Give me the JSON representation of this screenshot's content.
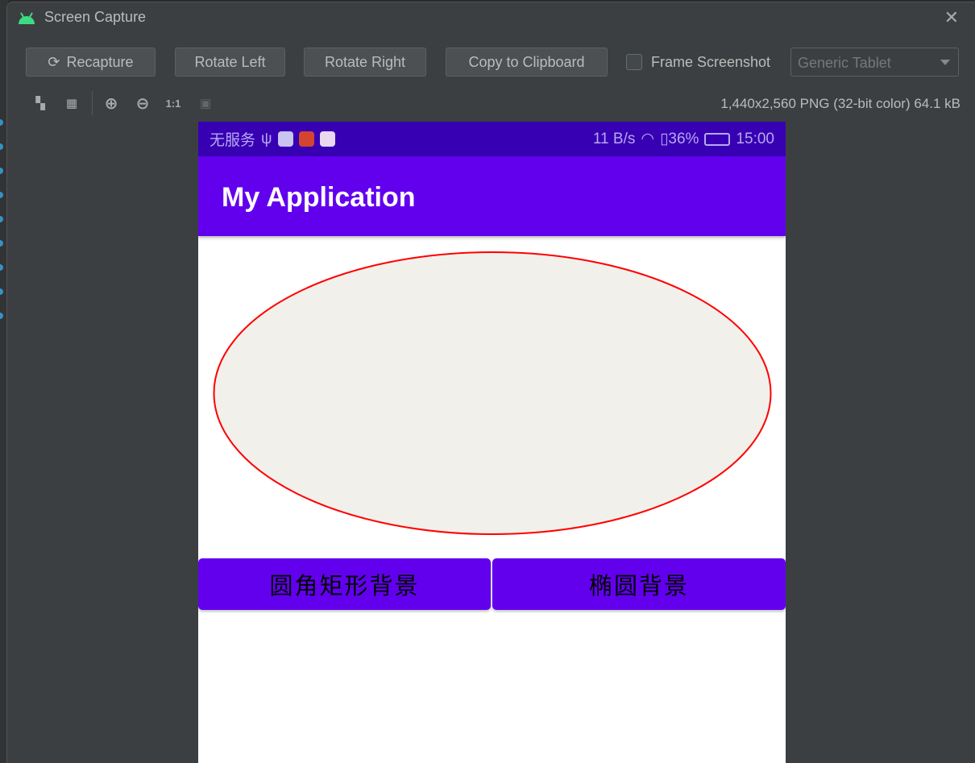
{
  "window": {
    "title": "Screen Capture"
  },
  "toolbar": {
    "recapture": "Recapture",
    "rotate_left": "Rotate Left",
    "rotate_right": "Rotate Right",
    "copy": "Copy to Clipboard",
    "frame_label": "Frame Screenshot",
    "frame_checked": false,
    "device": "Generic Tablet",
    "zoom_actual": "1:1"
  },
  "info": "1,440x2,560 PNG (32-bit color) 64.1 kB",
  "phone": {
    "status": {
      "carrier": "无服务",
      "speed": "11 B/s",
      "battery": "36%",
      "time": "15:00"
    },
    "app_title": "My Application",
    "button_left": "圆角矩形背景",
    "button_right": "椭圆背景",
    "colors": {
      "primary": "#6200ee",
      "status": "#3700b3",
      "ellipse_fill": "#f2f0eb",
      "ellipse_stroke": "#ff0000"
    }
  }
}
